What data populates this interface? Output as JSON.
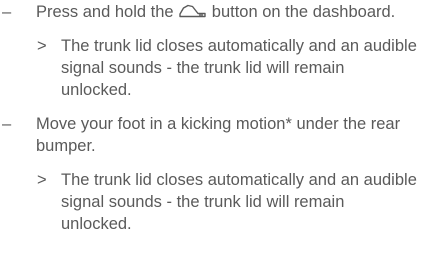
{
  "steps": [
    {
      "marker": "–",
      "text_before_icon": "Press and hold the ",
      "icon": "trunk-lid-icon",
      "text_after_icon": " button on the dash­board.",
      "result_marker": ">",
      "result": "The trunk lid closes automatically and an audible signal sounds - the trunk lid will remain unlocked."
    },
    {
      "marker": "–",
      "text": "Move your foot in a kicking motion* under the rear bumper.",
      "result_marker": ">",
      "result": "The trunk lid closes automatically and an audible signal sounds - the trunk lid will remain unlocked."
    }
  ]
}
